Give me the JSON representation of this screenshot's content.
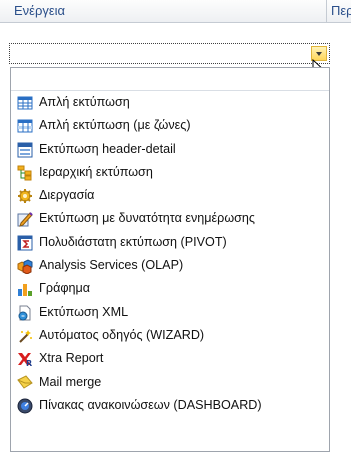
{
  "grid": {
    "column_energeia": "Ενέργεια",
    "column_next": "Περ"
  },
  "combo": {
    "value": ""
  },
  "menu": {
    "items": [
      {
        "label": "Απλή εκτύπωση",
        "icon": "simple-table-icon"
      },
      {
        "label": "Απλή εκτύπωση (με ζώνες)",
        "icon": "banded-table-icon"
      },
      {
        "label": "Εκτύπωση header-detail",
        "icon": "header-detail-icon"
      },
      {
        "label": "Ιεραρχική εκτύπωση",
        "icon": "hierarchy-icon"
      },
      {
        "label": "Διεργασία",
        "icon": "gear-process-icon"
      },
      {
        "label": "Εκτύπωση με δυνατότητα ενημέρωσης",
        "icon": "edit-report-icon"
      },
      {
        "label": "Πολυδιάστατη εκτύπωση (PIVOT)",
        "icon": "pivot-sigma-icon"
      },
      {
        "label": "Analysis Services (OLAP)",
        "icon": "olap-cubes-icon"
      },
      {
        "label": "Γράφημα",
        "icon": "bar-chart-icon"
      },
      {
        "label": "Εκτύπωση XML",
        "icon": "xml-file-icon"
      },
      {
        "label": "Αυτόματος οδηγός (WIZARD)",
        "icon": "magic-wand-icon"
      },
      {
        "label": "Xtra Report",
        "icon": "xtra-report-icon"
      },
      {
        "label": "Mail merge",
        "icon": "envelope-icon"
      },
      {
        "label": "Πίνακας ανακοινώσεων (DASHBOARD)",
        "icon": "dashboard-globe-icon"
      }
    ]
  }
}
